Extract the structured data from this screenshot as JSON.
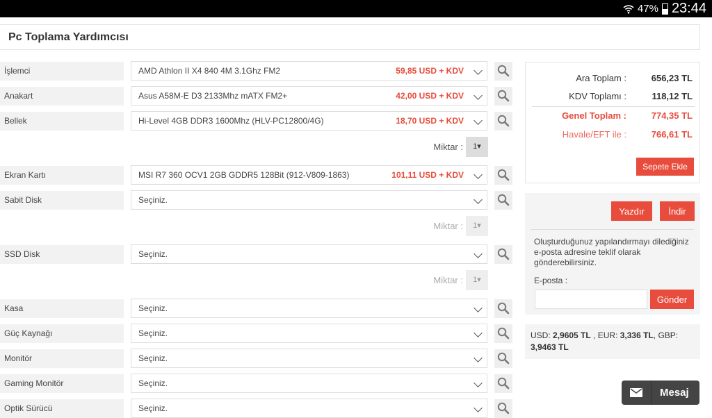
{
  "status": {
    "battery": "47%",
    "time": "23:44"
  },
  "title": "Pc Toplama Yardımcısı",
  "rows": [
    {
      "label": "İşlemci",
      "value": "AMD Athlon II X4 840 4M 3.1Ghz FM2",
      "price": "59,85 USD + KDV"
    },
    {
      "label": "Anakart",
      "value": "Asus A58M-E D3 2133Mhz mATX FM2+",
      "price": "42,00 USD + KDV"
    },
    {
      "label": "Bellek",
      "value": "Hi-Level 4GB DDR3 1600Mhz (HLV-PC12800/4G)",
      "price": "18,70 USD + KDV",
      "qty": {
        "label": "Miktar :",
        "value": "1",
        "enabled": true
      }
    },
    {
      "label": "Ekran Kartı",
      "value": "MSI R7 360 OCV1 2GB GDDR5 128Bit (912-V809-1863)",
      "price": "101,11 USD + KDV"
    },
    {
      "label": "Sabit Disk",
      "value": "Seçiniz.",
      "qty": {
        "label": "Miktar :",
        "value": "1",
        "enabled": false
      }
    },
    {
      "label": "SSD Disk",
      "value": "Seçiniz.",
      "qty": {
        "label": "Miktar :",
        "value": "1",
        "enabled": false
      }
    },
    {
      "label": "Kasa",
      "value": "Seçiniz."
    },
    {
      "label": "Güç Kaynağı",
      "value": "Seçiniz."
    },
    {
      "label": "Monitör",
      "value": "Seçiniz."
    },
    {
      "label": "Gaming Monitör",
      "value": "Seçiniz."
    },
    {
      "label": "Optik Sürücü",
      "value": "Seçiniz."
    }
  ],
  "summary": {
    "ara_label": "Ara Toplam :",
    "ara": "656,23 TL",
    "kdv_label": "KDV Toplamı :",
    "kdv": "118,12 TL",
    "genel_label": "Genel Toplam :",
    "genel": "774,35 TL",
    "havale_label": "Havale/EFT ile :",
    "havale": "766,61 TL",
    "add_to_cart": "Sepete Ekle"
  },
  "share": {
    "print": "Yazdır",
    "download": "İndir",
    "text": "Oluşturduğunuz yapılandırmayı dilediğiniz e-posta adresine teklif olarak gönderebilirsiniz.",
    "email_label": "E-posta :",
    "email_value": "",
    "send": "Gönder"
  },
  "rates": {
    "usd_label": "USD:",
    "usd": "2,9605 TL",
    "eur_label": ", EUR:",
    "eur": "3,336 TL",
    "gbp_label": ", GBP:",
    "gbp": "3,9463 TL"
  },
  "message": "Mesaj",
  "colors": {
    "accent": "#e74c3c"
  }
}
